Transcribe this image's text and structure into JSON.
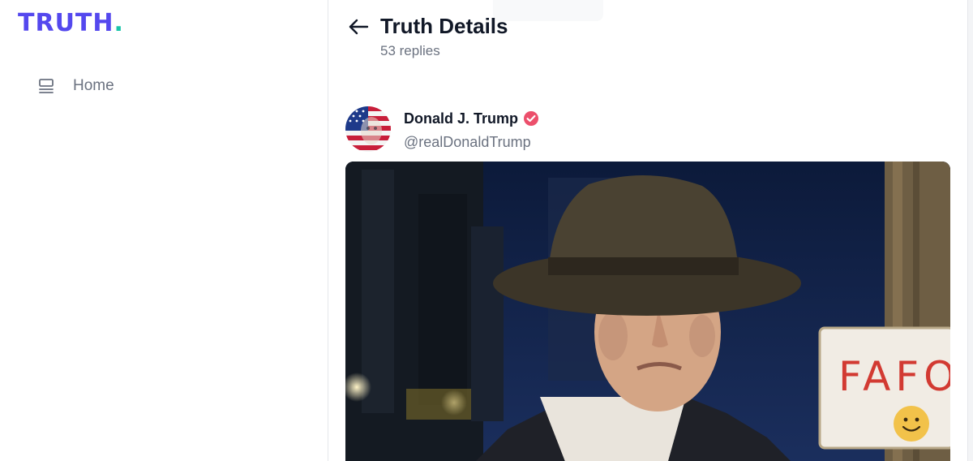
{
  "sidebar": {
    "logo_text": "TRUTH",
    "logo_dot": ".",
    "nav": [
      {
        "label": "Home",
        "icon": "home-icon"
      }
    ]
  },
  "header": {
    "back_icon": "arrow-left-icon",
    "title": "Truth Details",
    "replies": "53 replies"
  },
  "post": {
    "author_name": "Donald J. Trump",
    "author_handle": "@realDonaldTrump",
    "verified_icon": "verified-badge-icon",
    "media": {
      "sign_text": "FAFO"
    }
  },
  "colors": {
    "brand": "#5448ee",
    "brand_accent": "#18c4a8",
    "verified": "#ec4f6b",
    "muted_text": "#6b7280",
    "sign_text": "#d23a32"
  }
}
